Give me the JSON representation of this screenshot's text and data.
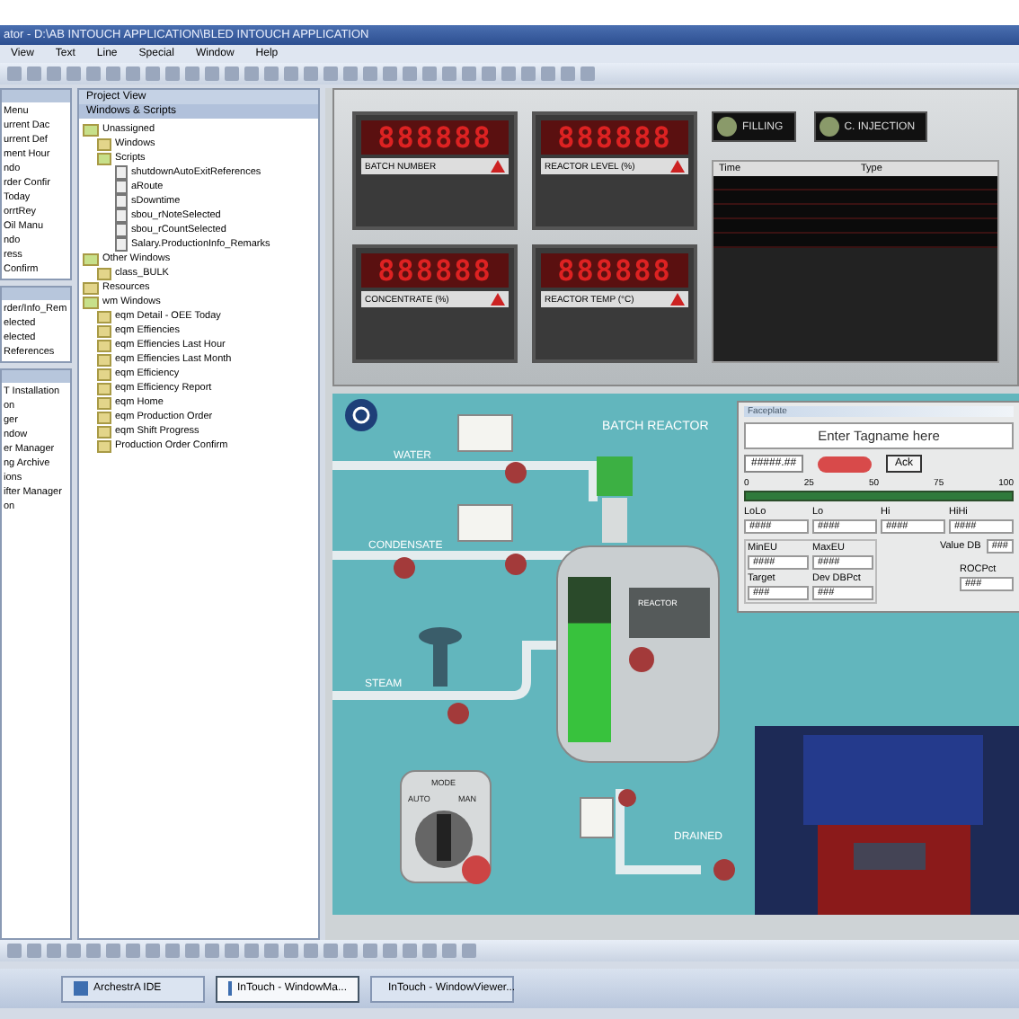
{
  "window": {
    "title": "ator - D:\\AB  INTOUCH APPLICATION\\BLED INTOUCH APPLICATION"
  },
  "menu": [
    "View",
    "Text",
    "Line",
    "Special",
    "Window",
    "Help"
  ],
  "left_panel": {
    "items": [
      "Menu",
      "urrent Dac",
      "urrent Def",
      "ment Hour",
      "ndo",
      "rder Confir",
      "Today",
      "orrtRey",
      "Oil Manu",
      "ndo",
      "ress",
      "Confirm"
    ],
    "lower_items": [
      "rder/Info_Rem",
      "elected",
      "elected",
      "References"
    ],
    "bottom_items": [
      "T Installation",
      "on",
      "ger",
      "ndow",
      "er Manager",
      "ng Archive",
      "ions",
      "ifter Manager",
      "on"
    ]
  },
  "project_view": {
    "title": "Project View",
    "section": "Windows & Scripts",
    "tree": [
      {
        "label": "Unassigned",
        "expanded": true,
        "children": [
          {
            "label": "Windows",
            "expanded": false
          },
          {
            "label": "Scripts",
            "expanded": true,
            "children": [
              {
                "label": "shutdownAutoExitReferences"
              },
              {
                "label": "aRoute"
              },
              {
                "label": "sDowntime"
              },
              {
                "label": "sbou_rNoteSelected"
              },
              {
                "label": "sbou_rCountSelected"
              },
              {
                "label": "Salary.ProductionInfo_Remarks"
              }
            ]
          }
        ]
      },
      {
        "label": "Other Windows",
        "expanded": true,
        "children": [
          {
            "label": "class_BULK"
          }
        ]
      },
      {
        "label": "Resources"
      },
      {
        "label": "wm Windows",
        "expanded": true,
        "children": [
          {
            "label": "eqm Detail - OEE Today"
          },
          {
            "label": "eqm Effiencies"
          },
          {
            "label": "eqm Effiencies Last Hour"
          },
          {
            "label": "eqm Effiencies Last Month"
          },
          {
            "label": "eqm Efficiency"
          },
          {
            "label": "eqm Efficiency Report"
          },
          {
            "label": "eqm Home"
          },
          {
            "label": "eqm Production Order"
          },
          {
            "label": "eqm Shift Progress"
          },
          {
            "label": "Production Order Confirm"
          }
        ]
      }
    ]
  },
  "displays": [
    {
      "digits": "888888",
      "label": "BATCH NUMBER"
    },
    {
      "digits": "888888",
      "label": "REACTOR LEVEL (%)"
    },
    {
      "digits": "888888",
      "label": "CONCENTRATE (%)"
    },
    {
      "digits": "888888",
      "label": "REACTOR TEMP (°C)"
    }
  ],
  "mode_buttons": [
    "FILLING",
    "C. INJECTION"
  ],
  "alarm_table": {
    "columns": [
      "Time",
      "Type"
    ]
  },
  "process": {
    "title": "BATCH REACTOR",
    "water": "WATER",
    "condensate": "CONDENSATE",
    "steam": "STEAM",
    "drained": "DRAINED",
    "reactor": "REACTOR",
    "mode": "MODE",
    "auto": "AUTO",
    "man": "MAN",
    "level": 0.72
  },
  "popup": {
    "title": "Faceplate",
    "tag_placeholder": "Enter Tagname here",
    "value": "#####.##",
    "ack": "Ack",
    "scale": [
      "0",
      "25",
      "50",
      "75",
      "100"
    ],
    "limits": [
      {
        "label": "LoLo",
        "value": "####"
      },
      {
        "label": "Lo",
        "value": "####"
      },
      {
        "label": "Hi",
        "value": "####"
      },
      {
        "label": "HiHi",
        "value": "####"
      }
    ],
    "value_db": {
      "label": "Value DB",
      "value": "###"
    },
    "range": [
      {
        "label": "MinEU",
        "value": "####"
      },
      {
        "label": "MaxEU",
        "value": "####"
      },
      {
        "label": "Target",
        "value": "###"
      },
      {
        "label": "Dev DBPct",
        "value": "###"
      }
    ],
    "roc": {
      "label": "ROCPct",
      "value": "###"
    }
  },
  "taskbar": [
    {
      "label": "ArchestrA IDE",
      "selected": false
    },
    {
      "label": "InTouch - WindowMa...",
      "selected": true
    },
    {
      "label": "InTouch - WindowViewer...",
      "selected": false
    }
  ]
}
